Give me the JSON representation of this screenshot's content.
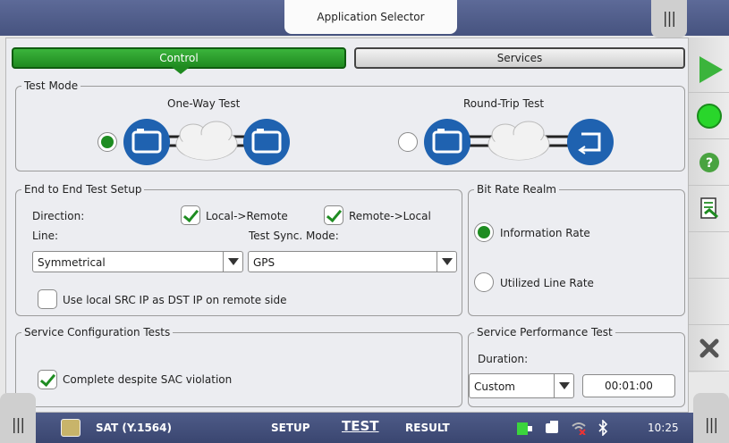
{
  "window": {
    "title": "Application Selector",
    "grip": "|||"
  },
  "tabs": {
    "control": "Control",
    "services": "Services"
  },
  "test_mode": {
    "legend": "Test Mode",
    "one_way": {
      "label": "One-Way Test",
      "selected": true
    },
    "round_trip": {
      "label": "Round-Trip Test",
      "selected": false
    }
  },
  "e2e": {
    "legend": "End to End Test Setup",
    "direction_label": "Direction:",
    "local_to_remote": {
      "label": "Local->Remote",
      "checked": true
    },
    "remote_to_local": {
      "label": "Remote->Local",
      "checked": true
    },
    "line_label": "Line:",
    "line_value": "Symmetrical",
    "sync_label": "Test Sync. Mode:",
    "sync_value": "GPS",
    "use_src_ip": {
      "label": "Use local SRC IP as DST IP on remote side",
      "checked": false
    }
  },
  "bit_rate": {
    "legend": "Bit Rate Realm",
    "information": {
      "label": "Information Rate",
      "selected": true
    },
    "utilized": {
      "label": "Utilized Line Rate",
      "selected": false
    }
  },
  "service_config": {
    "legend": "Service Configuration Tests",
    "complete_despite": {
      "label": "Complete despite SAC violation",
      "checked": true
    }
  },
  "service_perf": {
    "legend": "Service Performance Test",
    "duration_label": "Duration:",
    "duration_mode": "Custom",
    "duration_time": "00:01:00"
  },
  "sidebar": {
    "icons": [
      "play-icon",
      "status-light-icon",
      "help-icon",
      "report-icon",
      "close-icon"
    ],
    "colors": {
      "play": "#3bb43c",
      "status": "#29d62b",
      "help": "#49a340",
      "close": "#555555"
    }
  },
  "bottombar": {
    "grip": "|||",
    "app": "SAT (Y.1564)",
    "setup": "SETUP",
    "test": "TEST",
    "result": "RESULT",
    "time": "10:25"
  },
  "colors": {
    "accent_green": "#1e8c21",
    "header_blue": "#4e5b88",
    "device_blue": "#1f62b0"
  }
}
